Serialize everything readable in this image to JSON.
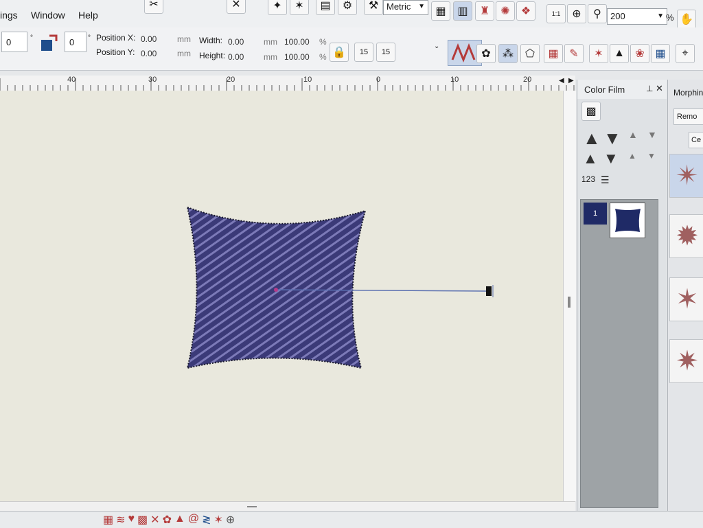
{
  "menu": {
    "items": [
      "ings",
      "Window",
      "Help"
    ]
  },
  "toolbar": {
    "units": "Metric",
    "zoom_value": "200",
    "zoom_unit": "%",
    "zoom_reset_label": "1:1"
  },
  "props": {
    "angle_value": "0",
    "degree_symbol": "°",
    "rotate_value": "0",
    "position_x_label": "Position X:",
    "position_y_label": "Position Y:",
    "position_x_value": "0.00",
    "position_y_value": "0.00",
    "width_label": "Width:",
    "height_label": "Height:",
    "width_value": "0.00",
    "height_value": "0.00",
    "width_percent": "100.00",
    "height_percent": "100.00",
    "unit_mm": "mm",
    "unit_pct": "%",
    "stitch_badge": "15"
  },
  "ruler": {
    "labels": [
      "40",
      "30",
      "20",
      "10",
      "0",
      "10",
      "20"
    ]
  },
  "color_film": {
    "title": "Color Film",
    "numbers_label": "123",
    "items": [
      {
        "index": "1"
      }
    ]
  },
  "morph": {
    "title": "Morphin",
    "remove_label": "Remo",
    "center_label": "Ce"
  },
  "colors": {
    "fabric": "#e9e8dd",
    "stitch": "#3b3a78",
    "highlight": "#7c7ab8",
    "accent": "#b43a3a",
    "selection": "#1f2a66"
  }
}
